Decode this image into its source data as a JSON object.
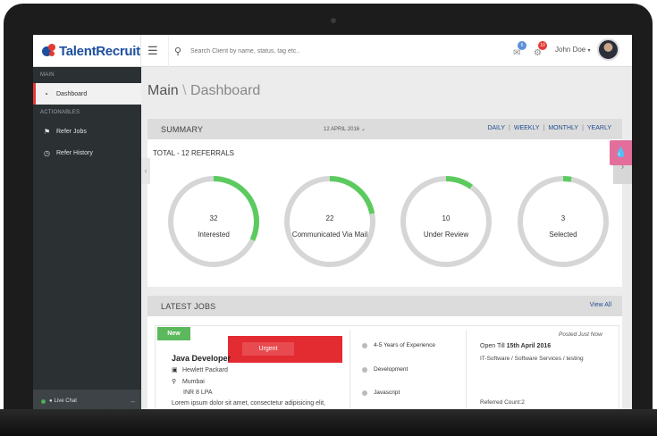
{
  "header": {
    "brand": "TalentRecruit",
    "search_placeholder": "Search Client by name, status, tag etc..",
    "messages_count": "6",
    "alerts_count": "10",
    "user_name": "John Doe"
  },
  "sidebar": {
    "section_main": "MAIN",
    "dashboard": "Dashboard",
    "section_actionables": "ACTIONABLES",
    "refer_jobs": "Refer Jobs",
    "refer_history": "Refer History",
    "live_chat": "Live Chat",
    "minimize": "–"
  },
  "page": {
    "title_main": "Main",
    "title_sep": "\\",
    "title_sub": "Dashboard"
  },
  "summary": {
    "title": "SUMMARY",
    "date": "12 APRIL 2016",
    "ranges": [
      "DAILY",
      "WEEKLY",
      "MONTHLY",
      "YEARLY"
    ],
    "total": "TOTAL - 12 REFERRALS",
    "stats": [
      {
        "value": "32",
        "label": "Interested",
        "fraction": 0.32
      },
      {
        "value": "22",
        "label": "Communicated Via Mail",
        "fraction": 0.22
      },
      {
        "value": "10",
        "label": "Under Review",
        "fraction": 0.1
      },
      {
        "value": "3",
        "label": "Selected",
        "fraction": 0.03
      }
    ],
    "colors": {
      "ring": "#d6d6d6",
      "progress": "#5ccb5f"
    }
  },
  "jobs": {
    "title": "LATEST JOBS",
    "view_all": "View All",
    "new_tag": "New",
    "urgent": "Urgent",
    "job": {
      "title": "Java Developer",
      "company": "Hewlett Packard",
      "location": "Mumbai",
      "salary": "INR 8 LPA",
      "description": "Lorem ipsum dolor sit amet, consectetur adipisicing elit,",
      "requirements": [
        "4-5 Years of Experience",
        "Development",
        "Javascript"
      ],
      "posted": "Posted Just Now",
      "open_till_prefix": "Open Till ",
      "open_till_date": "15th April 2016",
      "category": "IT-Software / Software Services / testing",
      "referred_count": "Referred Count:2"
    }
  },
  "icons": {
    "menu": "menu-icon",
    "search": "search-icon",
    "dashboard": "dashboard-icon",
    "flag": "flag-icon",
    "history": "clock-icon",
    "briefcase": "briefcase-icon",
    "pin": "map-pin-icon",
    "drop": "water-drop-icon"
  }
}
